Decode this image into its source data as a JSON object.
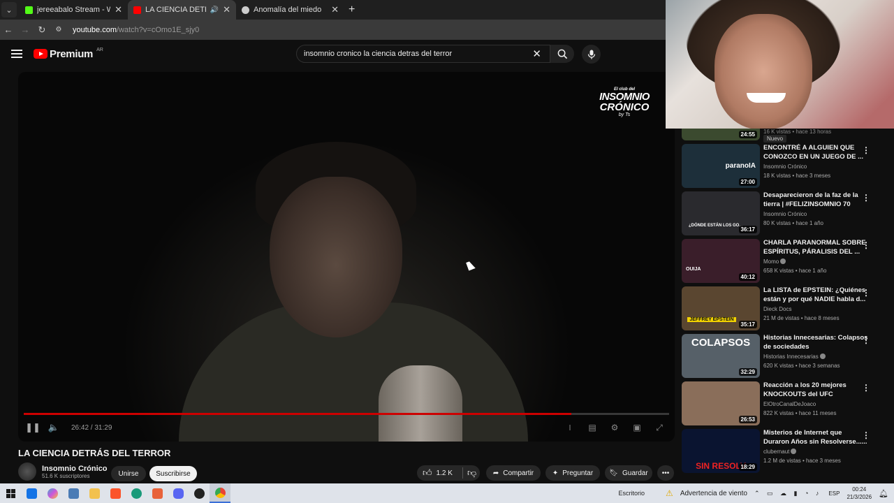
{
  "browser": {
    "tabs": [
      {
        "title": "jereeabalo Stream - Watch Live",
        "favicon_color": "#53fc18"
      },
      {
        "title": "LA CIENCIA DETRÁS DEL TERROR",
        "favicon_color": "#ff0000",
        "active": true
      },
      {
        "title": "Anomalía del miedo",
        "favicon_color": "#cccccc"
      }
    ],
    "new_tab": "+",
    "url_host": "youtube.com",
    "url_path": "/watch?v=cOmo1E_sjy0"
  },
  "youtube": {
    "logo": "Premium",
    "country": "AR",
    "search_value": "insomnio cronico la ciencia detras del terror"
  },
  "player": {
    "brand_line1": "El club del",
    "brand_line2": "INSOMNIO",
    "brand_line3": "CRÓNICO",
    "brand_line4": "by Ts",
    "time_current": "26:42",
    "time_total": "31:29",
    "time_sep": " / ",
    "progress": 0.848
  },
  "video": {
    "title": "LA CIENCIA DETRÁS DEL TERROR",
    "channel": "Insomnio Crónico",
    "subscribers": "51.6 K suscriptores",
    "join_label": "Unirse",
    "subscribe_label": "Suscribirse",
    "likes": "1.2 K",
    "share_label": "Compartir",
    "ask_label": "Preguntar",
    "save_label": "Guardar"
  },
  "sidebar": {
    "top": {
      "duration": "24:55",
      "meta": "16 K vistas • hace 13 horas",
      "badge": "Nuevo"
    },
    "items": [
      {
        "title": "ENCONTRÉ A ALGUIEN QUE CONOZCO EN UN JUEGO DE ...",
        "channel": "Insomnio Crónico",
        "meta": "18 K vistas • hace 3 meses",
        "duration": "27:00",
        "thumb_text": "paranoIA",
        "color": "#1d2f3a"
      },
      {
        "title": "Desaparecieron de la faz de la tierra | #FELIZINSOMNIO 70",
        "channel": "Insomnio Crónico",
        "meta": "80 K vistas • hace 1 año",
        "duration": "36:17",
        "thumb_text": "¿DÓNDE ESTÁN LOS GO...",
        "color": "#2a2a2e"
      },
      {
        "title": "CHARLA PARANORMAL SOBRE ESPÍRITUS, PÁRALISIS DEL ...",
        "channel": "Momo",
        "meta": "658 K vistas • hace 1 año",
        "duration": "40:12",
        "thumb_text": "OUIJA",
        "color": "#3a1e2a",
        "verified": true
      },
      {
        "title": "La LISTA de EPSTEIN: ¿Quiénes están y por qué NADIE habla d...",
        "channel": "Dieck Docs",
        "meta": "21 M de vistas • hace 8 meses",
        "duration": "35:17",
        "thumb_text": "JEFFREY EPSTEIN",
        "color": "#5a4630"
      },
      {
        "title": "Historias Innecesarias: Colapsos de sociedades",
        "channel": "Historias Innecesarias",
        "meta": "620 K vistas • hace 3 semanas",
        "duration": "32:29",
        "thumb_text": "COLAPSOS",
        "color": "#566068",
        "verified": true
      },
      {
        "title": "Reacción a los 20 mejores KNOCKOUTS del UFC",
        "channel": "ElOtroCanalDeJoaco",
        "meta": "822 K vistas • hace 11 meses",
        "duration": "26:53",
        "thumb_text": "",
        "color": "#8a6e5a"
      },
      {
        "title": "Misterios de Internet que Duraron Años sin Resolverse......",
        "channel": "clubernaut",
        "meta": "1.2 M de vistas • hace 3 meses",
        "duration": "18:29",
        "thumb_text": "SIN RESOLV",
        "color": "#0a1430",
        "verified": true
      }
    ]
  },
  "taskbar": {
    "desktop": "Escritorio",
    "weather": "Advertencia de viento",
    "lang": "ESP",
    "time": "00:24",
    "date": "21/3/2026"
  }
}
